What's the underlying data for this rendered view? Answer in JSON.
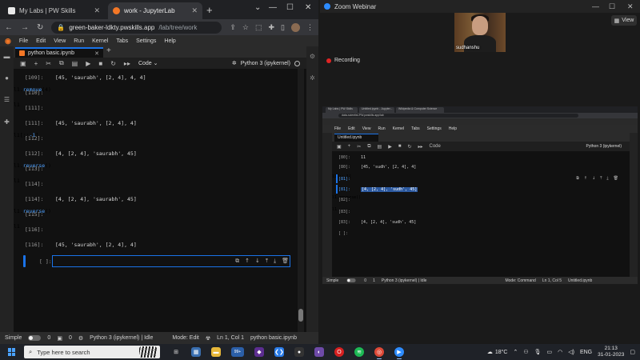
{
  "browser": {
    "tabs": [
      {
        "title": "My Labs | PW Skills",
        "favicon_color": "#e8e8e8"
      },
      {
        "title": "work - JupyterLab",
        "favicon_color": "#f37726"
      }
    ],
    "url_host": "green-baker-ldkty.pwskills.app",
    "url_path": "/lab/tree/work"
  },
  "jupyter": {
    "menu": [
      "File",
      "Edit",
      "View",
      "Run",
      "Kernel",
      "Tabs",
      "Settings",
      "Help"
    ],
    "notebook_tab": "python basic.ipynb",
    "cell_type": "Code",
    "kernel": "Python 3 (ipykernel)",
    "cells": [
      {
        "kind": "out",
        "prompt": "[109]:",
        "text": "[45, 'saurabh', [2, 4], 4, 4]"
      },
      {
        "kind": "in",
        "prompt": "[110]:",
        "pre": "l1.",
        "kw": "remove",
        "post": "(4)"
      },
      {
        "kind": "in",
        "prompt": "[111]:",
        "pre": "l1",
        "kw": "",
        "post": ""
      },
      {
        "kind": "out",
        "prompt": "[111]:",
        "text": "[45, 'saurabh', [2, 4], 4]"
      },
      {
        "kind": "in",
        "prompt": "[112]:",
        "pre": "l1[::",
        "kw": "-1",
        "post": "]"
      },
      {
        "kind": "out",
        "prompt": "[112]:",
        "text": "[4, [2, 4], 'saurabh', 45]"
      },
      {
        "kind": "in",
        "prompt": "[113]:",
        "pre": "l1.",
        "kw": "reverse",
        "post": "()"
      },
      {
        "kind": "in",
        "prompt": "[114]:",
        "pre": "l1",
        "kw": "",
        "post": ""
      },
      {
        "kind": "out",
        "prompt": "[114]:",
        "text": "[4, [2, 4], 'saurabh', 45]"
      },
      {
        "kind": "in",
        "prompt": "[115]:",
        "pre": "l1.",
        "kw": "reverse",
        "post": "()"
      },
      {
        "kind": "in",
        "prompt": "[116]:",
        "pre": "l1",
        "kw": "",
        "post": ""
      },
      {
        "kind": "out",
        "prompt": "[116]:",
        "text": "[45, 'saurabh', [2, 4], 4]"
      }
    ],
    "active_prompt": "[ ]:",
    "status": {
      "mode_label": "Simple",
      "count1": "0",
      "count2": "0",
      "kernel_state": "Python 3 (ipykernel) | Idle",
      "mode": "Mode: Edit",
      "position": "Ln 1, Col 1",
      "file": "python basic.ipynb"
    }
  },
  "zoom": {
    "title": "Zoom Webinar",
    "view_label": "View",
    "participant": "sudhanshu",
    "recording": "Recording",
    "shared": {
      "tabs": [
        "My Labs | PW Skills",
        "Untitled.ipynb - Jupyter...",
        "Wikipedia & Computer Science"
      ],
      "url": "data-scientist-PW.pwskills.app/lab",
      "menu": [
        "File",
        "Edit",
        "View",
        "Run",
        "Kernel",
        "Tabs",
        "Settings",
        "Help"
      ],
      "notebook_tab": "Untitled.ipynb",
      "cell_type": "Code",
      "kernel": "Python 3 (ipykernel)",
      "cells": [
        {
          "kind": "out",
          "prompt": "[80]:",
          "text": "11"
        },
        {
          "kind": "out",
          "prompt": "[80]:",
          "text": "[45, 'sudh', [2, 4], 4]"
        },
        {
          "kind": "in",
          "prompt": "[81]:",
          "text": "l1[::-1]",
          "sel": true
        },
        {
          "kind": "out",
          "prompt": "[81]:",
          "text": "[4, [2, 4], 'sudh', 45]",
          "hl": true
        },
        {
          "kind": "in",
          "prompt": "[82]:",
          "text": "l1.reverse()"
        },
        {
          "kind": "in",
          "prompt": "[83]:",
          "text": "l1"
        },
        {
          "kind": "out",
          "prompt": "[83]:",
          "text": "[4, [2, 4], 'sudh', 45]"
        },
        {
          "kind": "in",
          "prompt": "[ ]:",
          "text": ""
        }
      ],
      "status": {
        "mode_label": "Simple",
        "count1": "0",
        "count2": "1",
        "kernel_state": "Python 3 (ipykernel) | Idle",
        "mode": "Mode: Command",
        "position": "Ln 1, Col 5",
        "file": "Untitled.ipynb"
      }
    }
  },
  "taskbar": {
    "search_placeholder": "Type here to search",
    "badge": "99+",
    "weather": "18°C",
    "lang": "ENG",
    "time": "21:13",
    "date": "31-01-2023",
    "colors": {
      "accent": "#1a73e8",
      "jupyter_orange": "#f37726",
      "zoom_blue": "#2d8cff"
    }
  }
}
